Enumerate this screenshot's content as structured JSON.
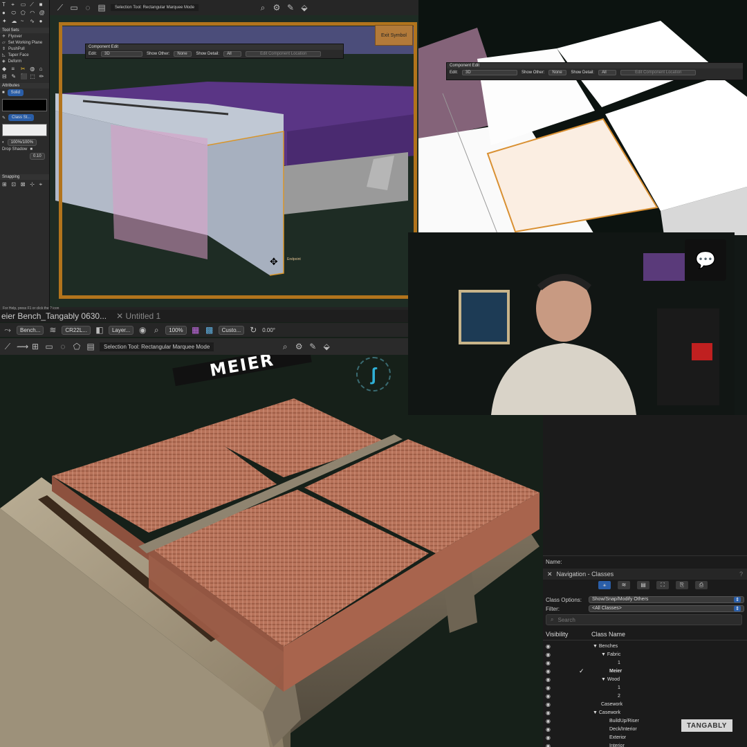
{
  "main": {
    "tabs": [
      {
        "label": "eier Bench_Tangably 0630..."
      },
      {
        "label": "Untitled 1"
      }
    ],
    "view_bar": {
      "class_dropdown": "Bench...",
      "render_dropdown": "CR22L...",
      "layer_dropdown": "Layer...",
      "zoom": "100%",
      "custom_dropdown": "Custo...",
      "angle": "0.00°"
    },
    "mode_label": "Selection Tool: Rectangular Marquee Mode",
    "floor_text": "MEIER"
  },
  "top_left": {
    "palette": {
      "tool_sets_title": "Tool Sets",
      "tools": [
        "Flyover",
        "Set Working Plane",
        "PushPull",
        "Taper Face",
        "Deform"
      ],
      "attributes_title": "Attributes",
      "fill_style": "Solid",
      "pen_style": "Class St...",
      "opacity": "100%/100%",
      "drop_shadow": "Drop Shadow",
      "shadow_value": "0.10",
      "snapping_title": "Snapping"
    },
    "mode_label": "Selection Tool: Rectangular Marquee Mode",
    "exit_symbol": "Exit Symbol",
    "component_edit": {
      "title": "Component Edit",
      "edit_label": "Edit:",
      "edit_value": "3D",
      "show_other_label": "Show Other:",
      "show_other_value": "None",
      "show_detail_label": "Show Detail:",
      "show_detail_value": "All",
      "location_button": "Edit Component Location"
    },
    "snap_label": "Endpoint",
    "status_text": "For Help, press F1 or click the ? icon"
  },
  "top_right": {
    "component_edit": {
      "title": "Component Edit",
      "edit_label": "Edit:",
      "edit_value": "3D",
      "show_other_label": "Show Other:",
      "show_other_value": "None",
      "show_detail_label": "Show Detail:",
      "show_detail_value": "All",
      "location_button": "Edit Component Location"
    }
  },
  "nav": {
    "name_label": "Name:",
    "title": "Navigation - Classes",
    "class_options_label": "Class Options:",
    "class_options_value": "Show/Snap/Modify Others",
    "filter_label": "Filter:",
    "filter_value": "<All Classes>",
    "search_placeholder": "Search",
    "col_visibility": "Visibility",
    "col_class_name": "Class Name",
    "rows": [
      {
        "name": "Benches",
        "indent": 1,
        "arrow": "▼",
        "checked": false
      },
      {
        "name": "Fabric",
        "indent": 2,
        "arrow": "▼",
        "checked": false
      },
      {
        "name": "1",
        "indent": 3,
        "arrow": "",
        "checked": false
      },
      {
        "name": "Meier",
        "indent": 2,
        "arrow": "",
        "checked": true
      },
      {
        "name": "Wood",
        "indent": 2,
        "arrow": "▼",
        "checked": false
      },
      {
        "name": "1",
        "indent": 3,
        "arrow": "",
        "checked": false
      },
      {
        "name": "2",
        "indent": 3,
        "arrow": "",
        "checked": false
      },
      {
        "name": "Casework",
        "indent": 1,
        "arrow": "",
        "checked": false
      },
      {
        "name": "Casework",
        "indent": 1,
        "arrow": "▼",
        "checked": false
      },
      {
        "name": "BuildUp/Riser",
        "indent": 2,
        "arrow": "",
        "checked": false
      },
      {
        "name": "Deck/Interior",
        "indent": 2,
        "arrow": "",
        "checked": false
      },
      {
        "name": "Exterior",
        "indent": 2,
        "arrow": "",
        "checked": false
      },
      {
        "name": "Interior",
        "indent": 2,
        "arrow": "",
        "checked": false
      }
    ]
  },
  "watermark": "TANGABLY"
}
